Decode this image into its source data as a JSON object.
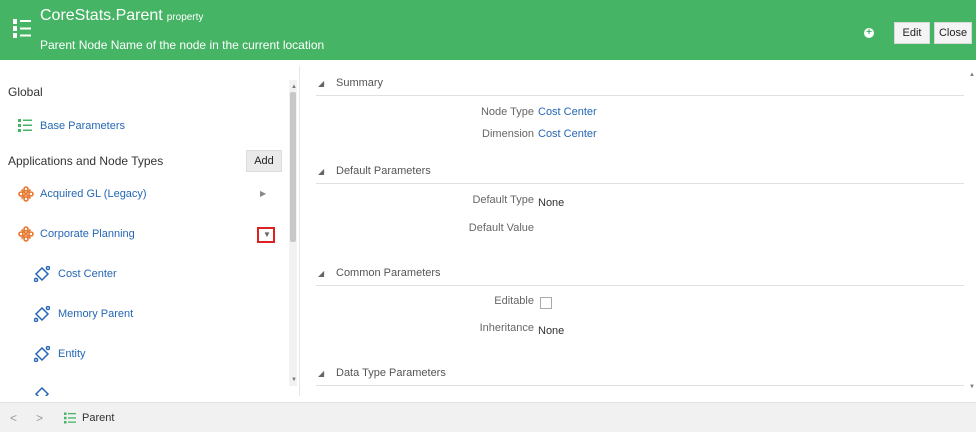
{
  "header": {
    "title": "CoreStats.Parent",
    "title_suffix": "property",
    "subtitle": "Parent Node Name of the node in the current location",
    "edit_label": "Edit",
    "close_label": "Close",
    "add_icon_glyph": "+",
    "background": "#46b465"
  },
  "left": {
    "global_label": "Global",
    "base_parameters": "Base Parameters",
    "apps_label": "Applications and Node Types",
    "add_label": "Add",
    "apps": [
      {
        "label": "Acquired GL (Legacy)",
        "icon": "app-icon",
        "expanded": false
      },
      {
        "label": "Corporate Planning",
        "icon": "app-icon",
        "expanded": true
      }
    ],
    "node_types": [
      {
        "label": "Cost Center",
        "icon": "node-type-icon"
      },
      {
        "label": "Memory Parent",
        "icon": "node-type-icon"
      },
      {
        "label": "Entity",
        "icon": "node-type-icon"
      }
    ]
  },
  "right": {
    "sections": {
      "summary": "Summary",
      "default_params": "Default Parameters",
      "common_params": "Common Parameters",
      "data_type_params": "Data Type Parameters"
    },
    "props": {
      "node_type_label": "Node Type",
      "node_type_value": "Cost Center",
      "dimension_label": "Dimension",
      "dimension_value": "Cost Center",
      "default_type_label": "Default Type",
      "default_type_value": "None",
      "default_value_label": "Default Value",
      "editable_label": "Editable",
      "inheritance_label": "Inheritance",
      "inheritance_value": "None"
    }
  },
  "footer": {
    "back_glyph": "<",
    "forward_glyph": ">",
    "tab_label": "Parent"
  },
  "colors": {
    "accent_green": "#46b465",
    "link_blue": "#2567b4",
    "app_icon_orange": "#e8772e",
    "highlight_red": "#dd2222"
  }
}
